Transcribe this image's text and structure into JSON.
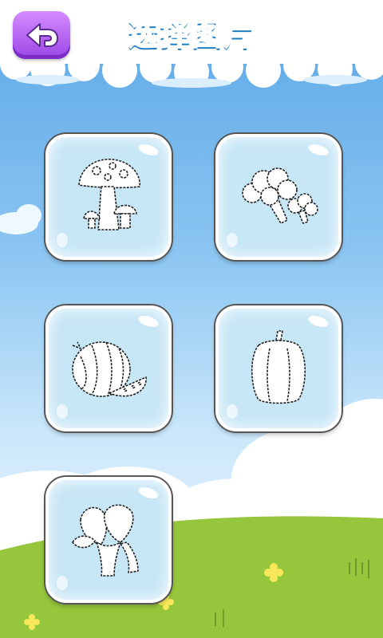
{
  "header": {
    "title": "选择图片",
    "back_icon": "back-arrow-icon"
  },
  "tiles": [
    {
      "name": "mushroom",
      "icon": "mushroom-icon"
    },
    {
      "name": "broccoli",
      "icon": "broccoli-icon"
    },
    {
      "name": "watermelon",
      "icon": "watermelon-icon"
    },
    {
      "name": "bell-pepper",
      "icon": "bell-pepper-icon"
    },
    {
      "name": "bok-choy",
      "icon": "bok-choy-icon"
    }
  ],
  "colors": {
    "sky_top": "#5aa6e6",
    "grass": "#95c63b",
    "back_button": "#a64fe9",
    "title": "#35aeea",
    "tile": "#c7e6f6"
  }
}
